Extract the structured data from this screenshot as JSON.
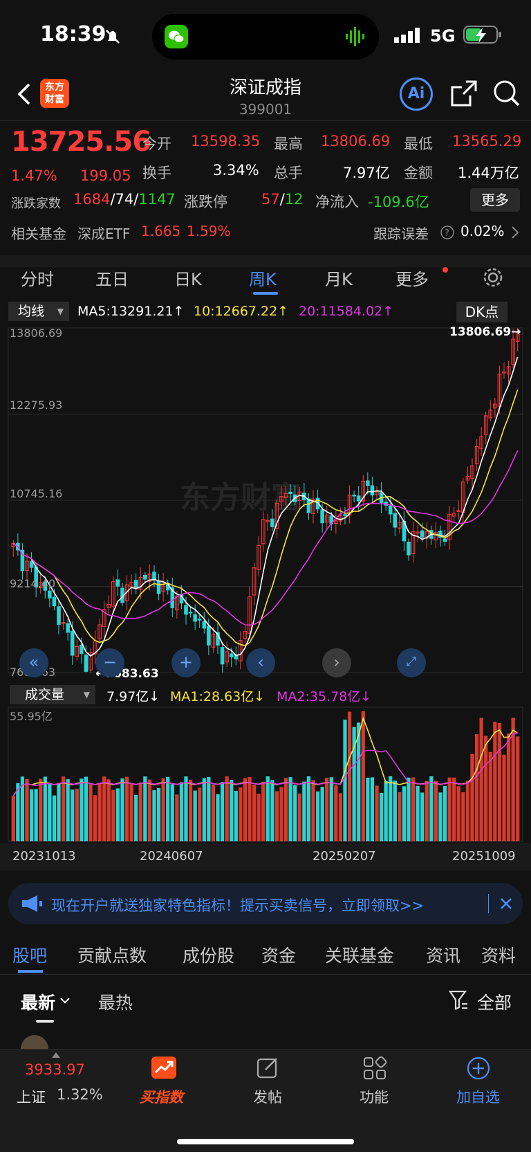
{
  "status_bar": {
    "time": "18:39",
    "network": "5G"
  },
  "header": {
    "title": "深证成指",
    "code": "399001",
    "logo_line1": "东方",
    "logo_line2": "财富",
    "ai_label": "Ai"
  },
  "quote": {
    "price": "13725.56",
    "change_pct": "1.47%",
    "change": "199.05",
    "open_label": "今开",
    "open": "13598.35",
    "high_label": "最高",
    "high": "13806.69",
    "low_label": "最低",
    "low": "13565.29",
    "turnover_label": "换手",
    "turnover": "3.34%",
    "volume_label": "总手",
    "volume": "7.97亿",
    "amount_label": "金额",
    "amount": "1.44万亿",
    "breadth_label": "涨跌家数",
    "up": "1684",
    "flat": "74",
    "down": "1147",
    "limit_label": "涨跌停",
    "limit_up": "57",
    "limit_down": "12",
    "netflow_label": "净流入",
    "netflow": "-109.6亿",
    "more": "更多",
    "fund_label": "相关基金",
    "fund_name": "深成ETF",
    "fund_price": "1.665",
    "fund_pct": "1.59%",
    "tracking_label": "跟踪误差",
    "tracking": "0.02%"
  },
  "kline_tabs": [
    "分时",
    "五日",
    "日K",
    "周K",
    "月K",
    "更多"
  ],
  "kline_active": "周K",
  "chart": {
    "ma_select": "均线",
    "ma5": "MA5:13291.21↑",
    "ma10": "10:12667.22↑",
    "ma20": "20:11584.02↑",
    "dk_label": "DK点",
    "high_marker": "13806.69→",
    "low_marker": "←7683.63",
    "y_labels": [
      "13806.69",
      "12275.93",
      "10745.16",
      "9214.40",
      "7683.63"
    ],
    "vol_select": "成交量",
    "vol": "7.97亿↓",
    "vol_ma1": "MA1:28.63亿↓",
    "vol_ma2": "MA2:35.78亿↓",
    "vol_max": "55.95亿",
    "dates": [
      "20231013",
      "20240607",
      "20250207",
      "20251009"
    ],
    "watermark": "东方财富",
    "colors": {
      "up": "#ff3b3b",
      "down": "#29d3d3",
      "ma5": "#ffffff",
      "ma10": "#f5e342",
      "ma20": "#e033e0"
    }
  },
  "chart_data": {
    "type": "candlestick",
    "ylim": [
      7683.63,
      13806.69
    ],
    "close_path": [
      9900,
      9600,
      9300,
      9000,
      8500,
      8100,
      7800,
      8500,
      9200,
      9100,
      9300,
      9400,
      9200,
      9000,
      8800,
      8600,
      8300,
      8000,
      7900,
      8600,
      10200,
      10400,
      10900,
      10800,
      10700,
      10500,
      10300,
      10600,
      10900,
      11000,
      10700,
      10400,
      9900,
      10200,
      10100,
      10100,
      10600,
      11200,
      11900,
      12500,
      13100,
      13725.56
    ],
    "volume_max": "55.95亿"
  },
  "banner": {
    "text": "现在开户就送独家特色指标！提示买卖信号，立即领取>>"
  },
  "section_tabs": [
    "股吧",
    "贡献点数",
    "成份股",
    "资金",
    "关联基金",
    "资讯",
    "资料"
  ],
  "section_active": "股吧",
  "sort": {
    "latest": "最新",
    "hot": "最热",
    "filter": "全部"
  },
  "bottom_bar": {
    "index_value": "3933.97",
    "index_name": "上证",
    "index_pct": "1.32%",
    "buy_index": "买指数",
    "post": "发帖",
    "functions": "功能",
    "add_watch": "加自选"
  }
}
